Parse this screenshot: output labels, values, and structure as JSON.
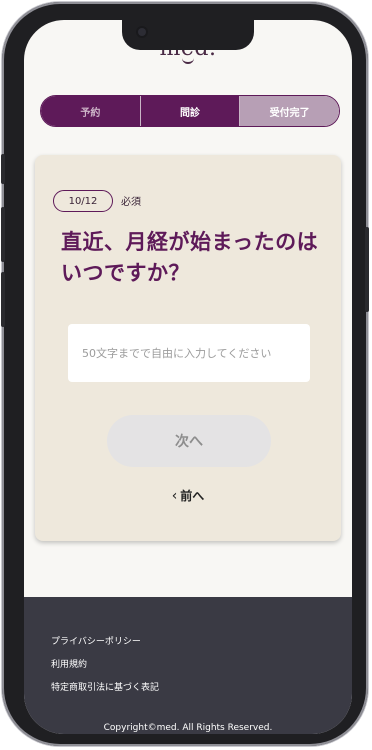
{
  "header": {
    "logo_text": "med."
  },
  "steps": [
    {
      "label": "予約"
    },
    {
      "label": "問診"
    },
    {
      "label": "受付完了"
    }
  ],
  "question": {
    "progress": "10/12",
    "required_label": "必須",
    "text": "直近、月経が始まったのはいつですか？",
    "input_value": "",
    "input_placeholder": "50文字までで自由に入力してください",
    "next_label": "次へ",
    "prev_label": "前へ"
  },
  "footer": {
    "links": [
      "プライバシーポリシー",
      "利用規約",
      "特定商取引法に基づく表記"
    ],
    "copyright": "Copyright©med. All Rights Reserved."
  },
  "colors": {
    "brand": "#5e1a59",
    "card_bg": "#eee8dc",
    "footer_bg": "#3a3a44",
    "step_done": "#b79fb5",
    "button_disabled": "#e4e3e4"
  },
  "icons": {
    "prev": "chevron-left-icon"
  }
}
